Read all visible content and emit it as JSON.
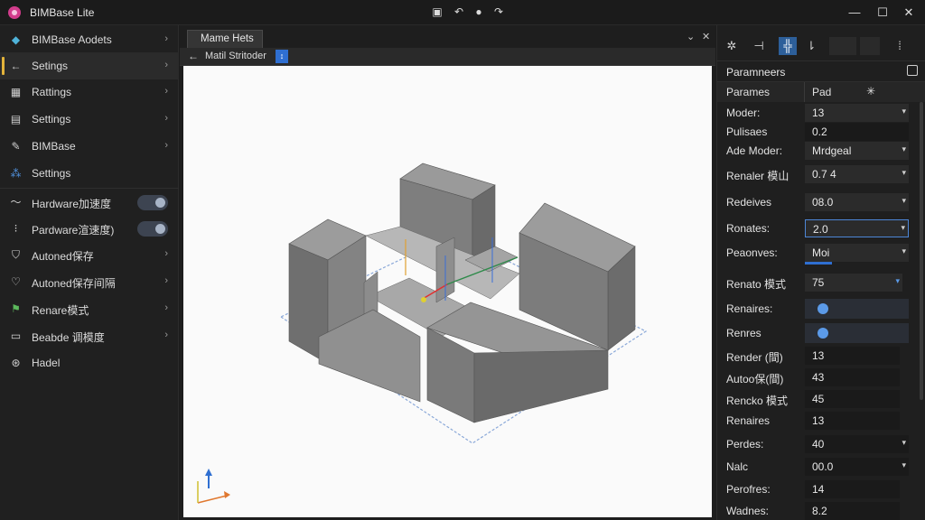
{
  "app": {
    "title": "BIMBase Lite"
  },
  "titlebar": {
    "icons": [
      "save-icon",
      "undo-icon",
      "paint-icon",
      "redo-icon"
    ],
    "window": {
      "minimize": "—",
      "maximize": "☐",
      "close": "✕"
    }
  },
  "sidebar": {
    "items": [
      {
        "label": "BIMBase Aodets",
        "icon": "cube-icon",
        "chevron": "›"
      },
      {
        "label": "Setings",
        "icon": "arrow-left-icon",
        "chevron": "›"
      },
      {
        "label": "Rattings",
        "icon": "grid-icon",
        "chevron": "›"
      },
      {
        "label": "Settings",
        "icon": "document-icon",
        "chevron": "›"
      },
      {
        "label": "BIMBase",
        "icon": "wrench-icon",
        "chevron": "›"
      },
      {
        "label": "Settings",
        "icon": "network-icon"
      },
      {
        "label": "Hardware加速度",
        "icon": "wave-icon",
        "toggle": true
      },
      {
        "label": "Pardware渲速度)",
        "icon": "dashes-icon",
        "toggle": true
      },
      {
        "label": "Autoned保存",
        "icon": "shield-icon",
        "chevron": "›"
      },
      {
        "label": "Autoned保存间隔",
        "icon": "heart-icon",
        "chevron": "›"
      },
      {
        "label": "Renare模式",
        "icon": "plug-icon",
        "chevron": "›"
      },
      {
        "label": "Beabde 调模度",
        "icon": "table-icon",
        "chevron": "›"
      },
      {
        "label": "Hadel",
        "icon": "help-icon"
      }
    ]
  },
  "center": {
    "tab_label": "Mame Hets",
    "controls": {
      "dropdown": "⌄",
      "close": "✕"
    },
    "subbar_label": "Matil Stritoder",
    "subbar_button": "↕"
  },
  "right": {
    "tools": [
      "gear-icon",
      "align-icon",
      "layout-icon",
      "chart-icon"
    ],
    "panel_title": "Paramneers",
    "columns": {
      "a": "Parames",
      "b": "Pad",
      "c": "✳"
    },
    "rows": [
      {
        "label": "Moder:",
        "value": "13",
        "arrow": "▾"
      },
      {
        "label": "Pulisaes",
        "value": "0.2"
      },
      {
        "label": "Ade Moder:",
        "value": "Mrdgeal",
        "arrow": "▾"
      },
      {
        "label": "Renaler 模山",
        "value": "0.7 4",
        "arrow": "▾"
      },
      {
        "label": "Redeives",
        "value": "08.0",
        "arrow": "▾"
      },
      {
        "label": "Ronates:",
        "value": "2.0",
        "arrow": "▾"
      },
      {
        "label": "Peaonves:",
        "value": "Moi",
        "arrow": "▾"
      },
      {
        "label": "Renato 模式",
        "value": "75",
        "arrow": "▾"
      },
      {
        "label": "Renaires:",
        "toggle": true
      },
      {
        "label": "Renres",
        "toggle": true
      },
      {
        "label": "Render (間)",
        "value": "13"
      },
      {
        "label": "Autoo保(間)",
        "value": "43"
      },
      {
        "label": "Rencko 模式",
        "value": "45"
      },
      {
        "label": "Renaires",
        "value": "13"
      },
      {
        "label": "Perdes:",
        "value": "40",
        "arrow": "▾"
      },
      {
        "label": "Nalc",
        "value": "00.0",
        "arrow": "▾"
      },
      {
        "label": "Perofres:",
        "value": "14"
      },
      {
        "label": "Wadnes:",
        "value": "8.2"
      }
    ]
  }
}
